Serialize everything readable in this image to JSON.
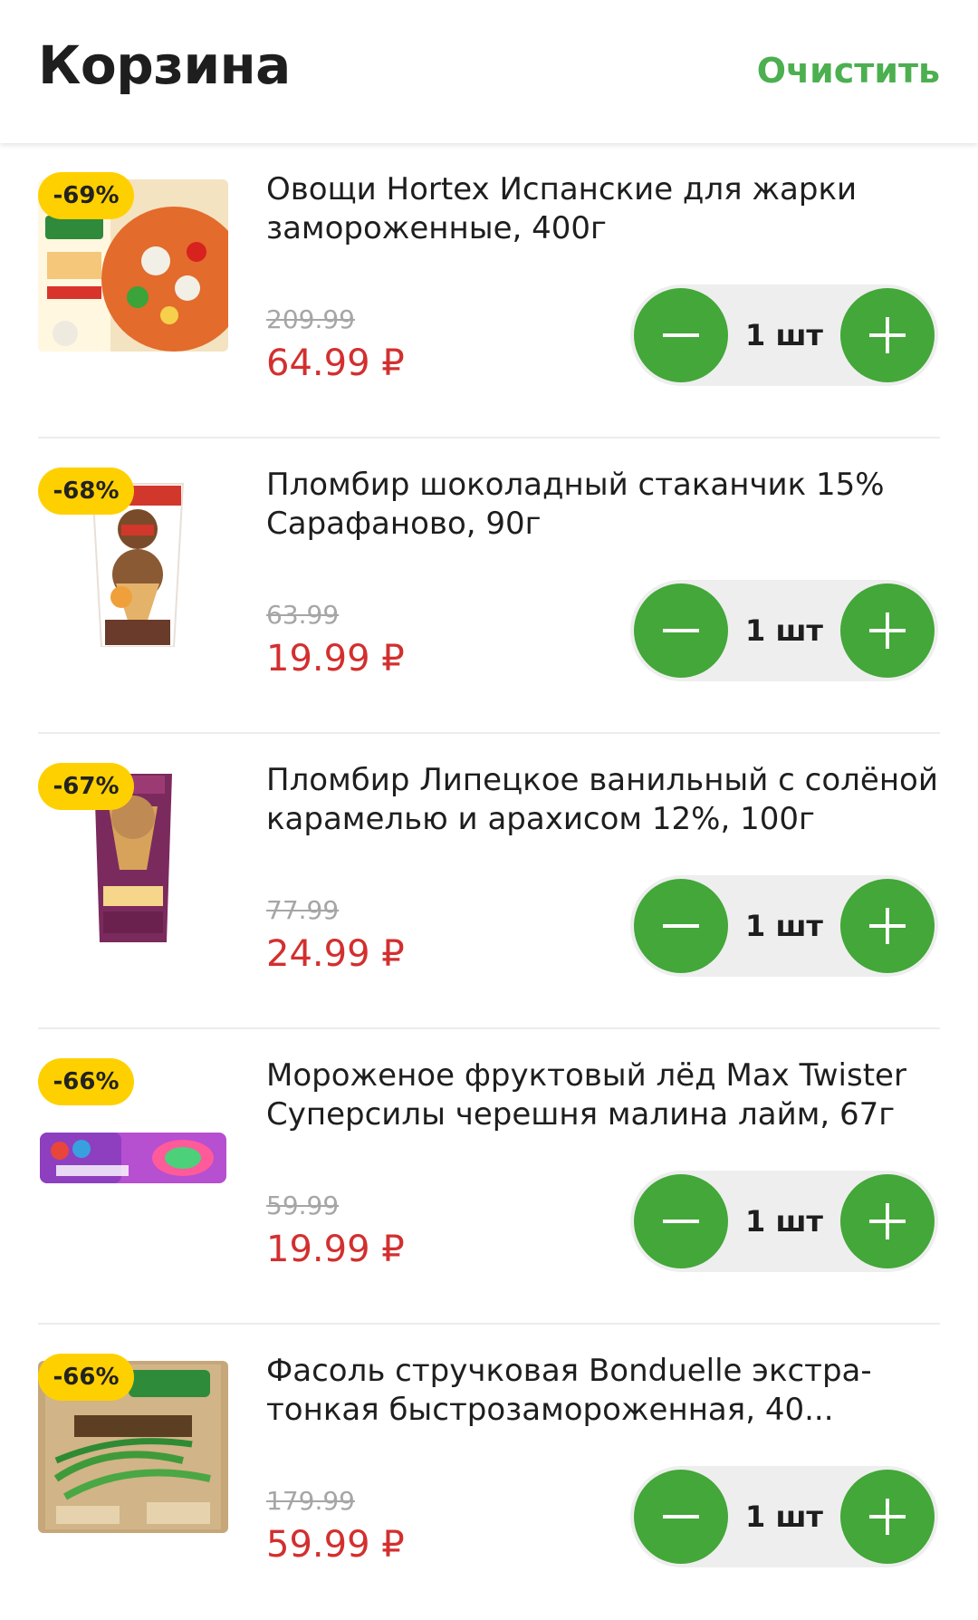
{
  "header": {
    "title": "Корзина",
    "clear_label": "Очистить"
  },
  "colors": {
    "accent": "#43a739",
    "badge": "#ffd000",
    "price": "#d32f2f"
  },
  "items": [
    {
      "discount": "-69%",
      "name": "Овощи Hortex Испанские для жарки замороженные, 400г",
      "old_price": "209.99",
      "new_price": "64.99 ₽",
      "qty": "1 шт",
      "image_icon": "frozen-vegetables-pack-icon"
    },
    {
      "discount": "-68%",
      "name": "Пломбир шоколадный стаканчик 15% Сарафаново, 90г",
      "old_price": "63.99",
      "new_price": "19.99 ₽",
      "qty": "1 шт",
      "image_icon": "ice-cream-cup-pack-icon"
    },
    {
      "discount": "-67%",
      "name": "Пломбир Липецкое ванильный с солёной карамелью и арахисом 12%, 100г",
      "old_price": "77.99",
      "new_price": "24.99 ₽",
      "qty": "1 шт",
      "image_icon": "ice-cream-cone-pack-icon"
    },
    {
      "discount": "-66%",
      "name": "Мороженое фруктовый лёд Max Twister Суперсилы черешня малина лайм, 67г",
      "old_price": "59.99",
      "new_price": "19.99 ₽",
      "qty": "1 шт",
      "image_icon": "fruit-ice-pack-icon"
    },
    {
      "discount": "-66%",
      "name": "Фасоль стручковая Bonduelle экстра-тонкая быстрозамороженная, 40...",
      "old_price": "179.99",
      "new_price": "59.99 ₽",
      "qty": "1 шт",
      "image_icon": "green-beans-pack-icon"
    }
  ]
}
